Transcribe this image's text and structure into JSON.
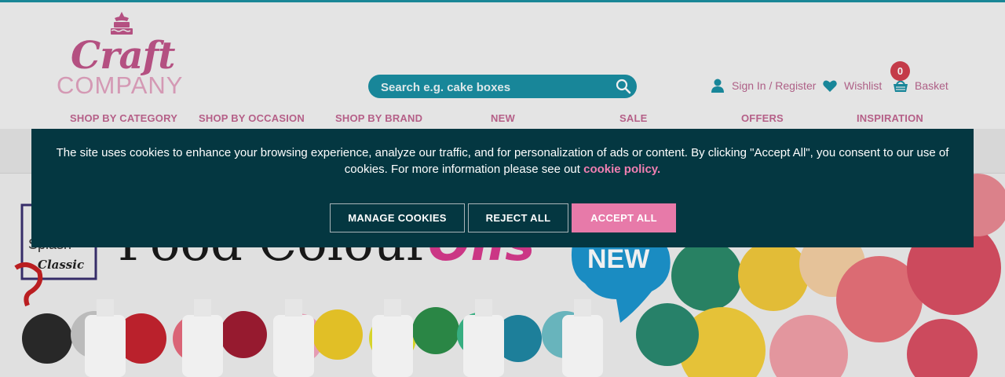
{
  "logo": {
    "line1": "Craft",
    "line2": "COMPANY"
  },
  "search": {
    "placeholder": "Search e.g. cake boxes"
  },
  "account": {
    "signin_label": "Sign In / Register",
    "wishlist_label": "Wishlist",
    "basket_label": "Basket",
    "basket_count": "0"
  },
  "nav": [
    "SHOP BY CATEGORY",
    "SHOP BY OCCASION",
    "SHOP BY BRAND",
    "NEW",
    "SALE",
    "OFFERS",
    "INSPIRATION"
  ],
  "hero": {
    "brand_line1": "Splash",
    "brand_line2": "Classic",
    "headline": "Food Colour",
    "headline_accent": "Oils",
    "badge": "NEW"
  },
  "cookie": {
    "message": "The site uses cookies to enhance your browsing experience, analyze our traffic, and for personalization of ads or content. By clicking \"Accept All\", you consent to our use of cookies. For more information please see out",
    "link_label": "cookie policy.",
    "manage_label": "MANAGE COOKIES",
    "reject_label": "REJECT ALL",
    "accept_label": "ACCEPT ALL"
  },
  "colors": {
    "accent_teal": "#1a8fa3",
    "brand_pink": "#c16691",
    "cookie_bg": "#043741",
    "accept_pink": "#e77aa9",
    "badge_red": "#d13f4e"
  }
}
